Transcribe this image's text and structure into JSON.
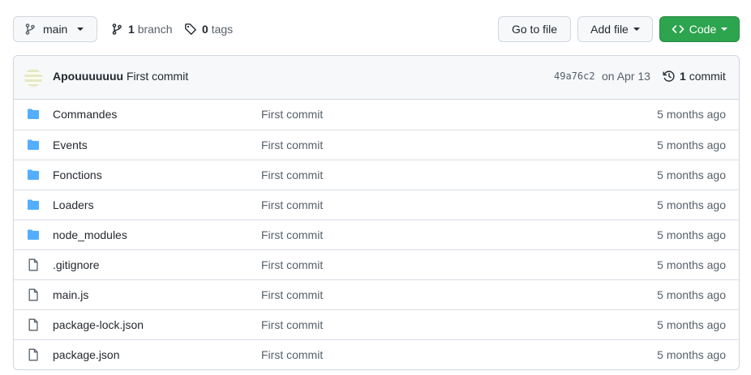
{
  "toolbar": {
    "branch_name": "main",
    "branch_count": "1",
    "branch_label": "branch",
    "tag_count": "0",
    "tag_label": "tags",
    "go_to_file": "Go to file",
    "add_file": "Add file",
    "code": "Code"
  },
  "latest_commit": {
    "author": "Apouuuuuuu",
    "message": "First commit",
    "sha": "49a76c2",
    "date": "on Apr 13",
    "count": "1",
    "count_label": "commit"
  },
  "files": [
    {
      "name": "Commandes",
      "type": "folder",
      "message": "First commit",
      "age": "5 months ago"
    },
    {
      "name": "Events",
      "type": "folder",
      "message": "First commit",
      "age": "5 months ago"
    },
    {
      "name": "Fonctions",
      "type": "folder",
      "message": "First commit",
      "age": "5 months ago"
    },
    {
      "name": "Loaders",
      "type": "folder",
      "message": "First commit",
      "age": "5 months ago"
    },
    {
      "name": "node_modules",
      "type": "folder",
      "message": "First commit",
      "age": "5 months ago"
    },
    {
      "name": ".gitignore",
      "type": "file",
      "message": "First commit",
      "age": "5 months ago"
    },
    {
      "name": "main.js",
      "type": "file",
      "message": "First commit",
      "age": "5 months ago"
    },
    {
      "name": "package-lock.json",
      "type": "file",
      "message": "First commit",
      "age": "5 months ago"
    },
    {
      "name": "package.json",
      "type": "file",
      "message": "First commit",
      "age": "5 months ago"
    }
  ],
  "colors": {
    "folder": "#54aeff",
    "file_icon": "#57606a",
    "code_button": "#2da44e"
  }
}
